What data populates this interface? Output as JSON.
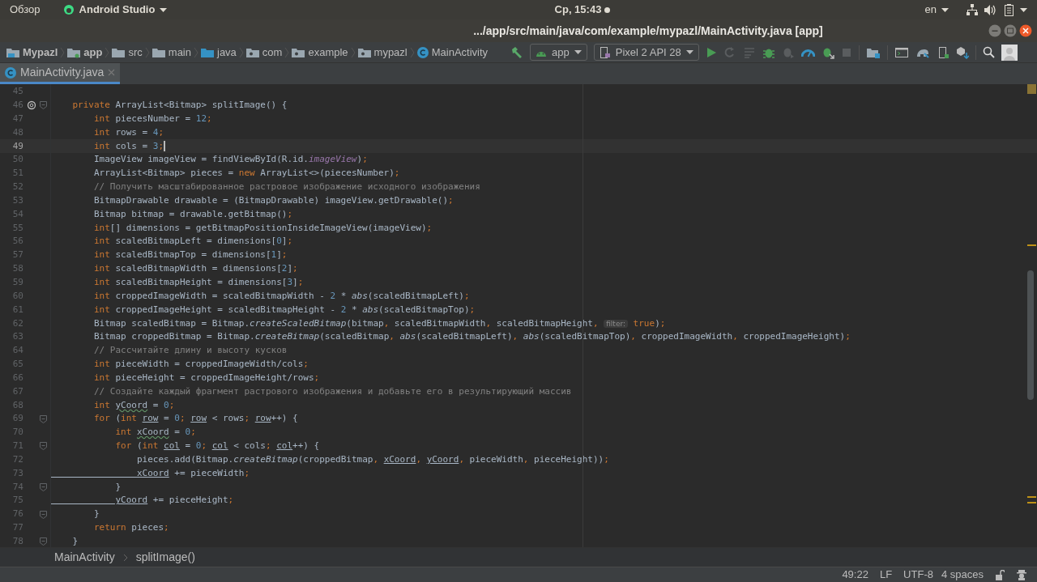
{
  "top_bar": {
    "activities": "Обзор",
    "app_menu": "Android Studio",
    "clock": "Ср, 15:43",
    "keyboard_layout": "en"
  },
  "window": {
    "title": ".../app/src/main/java/com/example/mypazl/MainActivity.java [app]"
  },
  "nav_path": [
    {
      "label": "Mypazl",
      "kind": "project"
    },
    {
      "label": "app",
      "kind": "module"
    },
    {
      "label": "src",
      "kind": "folder"
    },
    {
      "label": "main",
      "kind": "folder"
    },
    {
      "label": "java",
      "kind": "source"
    },
    {
      "label": "com",
      "kind": "package"
    },
    {
      "label": "example",
      "kind": "package"
    },
    {
      "label": "mypazl",
      "kind": "package"
    },
    {
      "label": "MainActivity",
      "kind": "class"
    }
  ],
  "toolbar": {
    "run_config": "app",
    "device": "Pixel 2 API 28"
  },
  "tabs": [
    {
      "label": "MainActivity.java",
      "selected": true
    }
  ],
  "editor": {
    "lines": [
      {
        "number": "45",
        "current": false,
        "override": false,
        "fold": false
      },
      {
        "number": "46",
        "current": false,
        "override": true,
        "fold": true,
        "tokens": [
          {
            "text": "    private",
            "kind": "keyword"
          },
          {
            "text": " ArrayList<Bitmap> splitImage() {",
            "kind": "plain"
          }
        ]
      },
      {
        "number": "47",
        "current": false,
        "override": false,
        "fold": false,
        "tokens": [
          {
            "text": "        int",
            "kind": "keyword"
          },
          {
            "text": " piecesNumber = ",
            "kind": "plain"
          },
          {
            "text": "12",
            "kind": "number"
          },
          {
            "text": ";",
            "kind": "keyword"
          }
        ]
      },
      {
        "number": "48",
        "current": false,
        "override": false,
        "fold": false,
        "tokens": [
          {
            "text": "        int",
            "kind": "keyword"
          },
          {
            "text": " rows = ",
            "kind": "plain"
          },
          {
            "text": "4",
            "kind": "number"
          },
          {
            "text": ";",
            "kind": "keyword"
          }
        ]
      },
      {
        "number": "49",
        "current": true,
        "override": false,
        "fold": false,
        "tokens": [
          {
            "text": "        int",
            "kind": "keyword"
          },
          {
            "text": " cols = ",
            "kind": "plain"
          },
          {
            "text": "3",
            "kind": "number"
          },
          {
            "text": ";",
            "kind": "keyword"
          }
        ]
      },
      {
        "number": "50",
        "current": false,
        "override": false,
        "fold": false,
        "tokens": [
          {
            "text": "        ImageView imageView = findViewById(R.id.",
            "kind": "plain"
          },
          {
            "text": "imageView",
            "kind": "field"
          },
          {
            "text": ")",
            "kind": "plain"
          },
          {
            "text": ";",
            "kind": "keyword"
          }
        ]
      },
      {
        "number": "51",
        "current": false,
        "override": false,
        "fold": false,
        "tokens": [
          {
            "text": "        ArrayList<Bitmap> pieces = ",
            "kind": "plain"
          },
          {
            "text": "new",
            "kind": "keyword"
          },
          {
            "text": " ArrayList<>(piecesNumber)",
            "kind": "plain"
          },
          {
            "text": ";",
            "kind": "keyword"
          }
        ]
      },
      {
        "number": "52",
        "current": false,
        "override": false,
        "fold": false,
        "tokens": [
          {
            "text": "        // Получить масштабированное растровое изображение исходного изображения",
            "kind": "comment"
          }
        ]
      },
      {
        "number": "53",
        "current": false,
        "override": false,
        "fold": false,
        "tokens": [
          {
            "text": "        BitmapDrawable drawable = (BitmapDrawable) imageView.getDrawable()",
            "kind": "plain"
          },
          {
            "text": ";",
            "kind": "keyword"
          }
        ]
      },
      {
        "number": "54",
        "current": false,
        "override": false,
        "fold": false,
        "tokens": [
          {
            "text": "        Bitmap bitmap = drawable.getBitmap()",
            "kind": "plain"
          },
          {
            "text": ";",
            "kind": "keyword"
          }
        ]
      },
      {
        "number": "55",
        "current": false,
        "override": false,
        "fold": false,
        "tokens": [
          {
            "text": "        int",
            "kind": "keyword"
          },
          {
            "text": "[] dimensions = getBitmapPositionInsideImageView(imageView)",
            "kind": "plain"
          },
          {
            "text": ";",
            "kind": "keyword"
          }
        ]
      },
      {
        "number": "56",
        "current": false,
        "override": false,
        "fold": false,
        "tokens": [
          {
            "text": "        int",
            "kind": "keyword"
          },
          {
            "text": " scaledBitmapLeft = dimensions[",
            "kind": "plain"
          },
          {
            "text": "0",
            "kind": "number"
          },
          {
            "text": "]",
            "kind": "plain"
          },
          {
            "text": ";",
            "kind": "keyword"
          }
        ]
      },
      {
        "number": "57",
        "current": false,
        "override": false,
        "fold": false,
        "tokens": [
          {
            "text": "        int",
            "kind": "keyword"
          },
          {
            "text": " scaledBitmapTop = dimensions[",
            "kind": "plain"
          },
          {
            "text": "1",
            "kind": "number"
          },
          {
            "text": "]",
            "kind": "plain"
          },
          {
            "text": ";",
            "kind": "keyword"
          }
        ]
      },
      {
        "number": "58",
        "current": false,
        "override": false,
        "fold": false,
        "tokens": [
          {
            "text": "        int",
            "kind": "keyword"
          },
          {
            "text": " scaledBitmapWidth = dimensions[",
            "kind": "plain"
          },
          {
            "text": "2",
            "kind": "number"
          },
          {
            "text": "]",
            "kind": "plain"
          },
          {
            "text": ";",
            "kind": "keyword"
          }
        ]
      },
      {
        "number": "59",
        "current": false,
        "override": false,
        "fold": false,
        "tokens": [
          {
            "text": "        int",
            "kind": "keyword"
          },
          {
            "text": " scaledBitmapHeight = dimensions[",
            "kind": "plain"
          },
          {
            "text": "3",
            "kind": "number"
          },
          {
            "text": "]",
            "kind": "plain"
          },
          {
            "text": ";",
            "kind": "keyword"
          }
        ]
      },
      {
        "number": "60",
        "current": false,
        "override": false,
        "fold": false,
        "tokens": [
          {
            "text": "        int",
            "kind": "keyword"
          },
          {
            "text": " croppedImageWidth = scaledBitmapWidth - ",
            "kind": "plain"
          },
          {
            "text": "2",
            "kind": "number"
          },
          {
            "text": " * ",
            "kind": "plain"
          },
          {
            "text": "abs",
            "kind": "static"
          },
          {
            "text": "(scaledBitmapLeft)",
            "kind": "plain"
          },
          {
            "text": ";",
            "kind": "keyword"
          }
        ]
      },
      {
        "number": "61",
        "current": false,
        "override": false,
        "fold": false,
        "tokens": [
          {
            "text": "        int",
            "kind": "keyword"
          },
          {
            "text": " croppedImageHeight = scaledBitmapHeight - ",
            "kind": "plain"
          },
          {
            "text": "2",
            "kind": "number"
          },
          {
            "text": " * ",
            "kind": "plain"
          },
          {
            "text": "abs",
            "kind": "static"
          },
          {
            "text": "(scaledBitmapTop)",
            "kind": "plain"
          },
          {
            "text": ";",
            "kind": "keyword"
          }
        ]
      },
      {
        "number": "62",
        "current": false,
        "override": false,
        "fold": false,
        "tokens": [
          {
            "text": "        Bitmap scaledBitmap = Bitmap.",
            "kind": "plain"
          },
          {
            "text": "createScaledBitmap",
            "kind": "static"
          },
          {
            "text": "(bitmap",
            "kind": "plain"
          },
          {
            "text": ",",
            "kind": "keyword"
          },
          {
            "text": " scaledBitmapWidth",
            "kind": "plain"
          },
          {
            "text": ",",
            "kind": "keyword"
          },
          {
            "text": " scaledBitmapHeight",
            "kind": "plain"
          },
          {
            "text": ", ",
            "kind": "keyword"
          },
          {
            "text": "filter:",
            "kind": "hint"
          },
          {
            "text": " true",
            "kind": "keyword"
          },
          {
            "text": ")",
            "kind": "plain"
          },
          {
            "text": ";",
            "kind": "keyword"
          }
        ]
      },
      {
        "number": "63",
        "current": false,
        "override": false,
        "fold": false,
        "tokens": [
          {
            "text": "        Bitmap croppedBitmap = Bitmap.",
            "kind": "plain"
          },
          {
            "text": "createBitmap",
            "kind": "static"
          },
          {
            "text": "(scaledBitmap",
            "kind": "plain"
          },
          {
            "text": ", ",
            "kind": "keyword"
          },
          {
            "text": "abs",
            "kind": "static"
          },
          {
            "text": "(scaledBitmapLeft)",
            "kind": "plain"
          },
          {
            "text": ", ",
            "kind": "keyword"
          },
          {
            "text": "abs",
            "kind": "static"
          },
          {
            "text": "(scaledBitmapTop)",
            "kind": "plain"
          },
          {
            "text": ",",
            "kind": "keyword"
          },
          {
            "text": " croppedImageWidth",
            "kind": "plain"
          },
          {
            "text": ",",
            "kind": "keyword"
          },
          {
            "text": " croppedImageHeight)",
            "kind": "plain"
          },
          {
            "text": ";",
            "kind": "keyword"
          }
        ]
      },
      {
        "number": "64",
        "current": false,
        "override": false,
        "fold": false,
        "tokens": [
          {
            "text": "        // Рассчитайте длину и высоту кусков",
            "kind": "comment"
          }
        ]
      },
      {
        "number": "65",
        "current": false,
        "override": false,
        "fold": false,
        "tokens": [
          {
            "text": "        int",
            "kind": "keyword"
          },
          {
            "text": " pieceWidth = croppedImageWidth/cols",
            "kind": "plain"
          },
          {
            "text": ";",
            "kind": "keyword"
          }
        ]
      },
      {
        "number": "66",
        "current": false,
        "override": false,
        "fold": false,
        "tokens": [
          {
            "text": "        int",
            "kind": "keyword"
          },
          {
            "text": " pieceHeight = croppedImageHeight/rows",
            "kind": "plain"
          },
          {
            "text": ";",
            "kind": "keyword"
          }
        ]
      },
      {
        "number": "67",
        "current": false,
        "override": false,
        "fold": false,
        "tokens": [
          {
            "text": "        // Создайте каждый фрагмент растрового изображения и добавьте его в результирующий массив",
            "kind": "comment"
          }
        ]
      },
      {
        "number": "68",
        "current": false,
        "override": false,
        "fold": false,
        "tokens": [
          {
            "text": "        int ",
            "kind": "keyword"
          },
          {
            "text": "yCoord",
            "kind": "typo"
          },
          {
            "text": " = ",
            "kind": "plain"
          },
          {
            "text": "0",
            "kind": "number"
          },
          {
            "text": ";",
            "kind": "keyword"
          }
        ]
      },
      {
        "number": "69",
        "current": false,
        "override": false,
        "fold": true,
        "tokens": [
          {
            "text": "        for",
            "kind": "keyword"
          },
          {
            "text": " (",
            "kind": "plain"
          },
          {
            "text": "int ",
            "kind": "keyword"
          },
          {
            "text": "row",
            "kind": "reassigned"
          },
          {
            "text": " = ",
            "kind": "plain"
          },
          {
            "text": "0",
            "kind": "number"
          },
          {
            "text": "; ",
            "kind": "keyword"
          },
          {
            "text": "row",
            "kind": "reassigned"
          },
          {
            "text": " < rows",
            "kind": "plain"
          },
          {
            "text": "; ",
            "kind": "keyword"
          },
          {
            "text": "row",
            "kind": "reassigned"
          },
          {
            "text": "++) {",
            "kind": "plain"
          }
        ]
      },
      {
        "number": "70",
        "current": false,
        "override": false,
        "fold": false,
        "tokens": [
          {
            "text": "            int ",
            "kind": "keyword"
          },
          {
            "text": "xCoord",
            "kind": "typo"
          },
          {
            "text": " = ",
            "kind": "plain"
          },
          {
            "text": "0",
            "kind": "number"
          },
          {
            "text": ";",
            "kind": "keyword"
          }
        ]
      },
      {
        "number": "71",
        "current": false,
        "override": false,
        "fold": true,
        "tokens": [
          {
            "text": "            for",
            "kind": "keyword"
          },
          {
            "text": " (",
            "kind": "plain"
          },
          {
            "text": "int ",
            "kind": "keyword"
          },
          {
            "text": "col",
            "kind": "reassigned"
          },
          {
            "text": " = ",
            "kind": "plain"
          },
          {
            "text": "0",
            "kind": "number"
          },
          {
            "text": "; ",
            "kind": "keyword"
          },
          {
            "text": "col",
            "kind": "reassigned"
          },
          {
            "text": " < cols",
            "kind": "plain"
          },
          {
            "text": "; ",
            "kind": "keyword"
          },
          {
            "text": "col",
            "kind": "reassigned"
          },
          {
            "text": "++) {",
            "kind": "plain"
          }
        ]
      },
      {
        "number": "72",
        "current": false,
        "override": false,
        "fold": false,
        "tokens": [
          {
            "text": "                pieces.add(Bitmap.",
            "kind": "plain"
          },
          {
            "text": "createBitmap",
            "kind": "static"
          },
          {
            "text": "(croppedBitmap",
            "kind": "plain"
          },
          {
            "text": ", ",
            "kind": "keyword"
          },
          {
            "text": "xCoord",
            "kind": "reassigned"
          },
          {
            "text": ", ",
            "kind": "keyword"
          },
          {
            "text": "yCoord",
            "kind": "reassigned"
          },
          {
            "text": ",",
            "kind": "keyword"
          },
          {
            "text": " pieceWidth",
            "kind": "plain"
          },
          {
            "text": ",",
            "kind": "keyword"
          },
          {
            "text": " pieceHeight))",
            "kind": "plain"
          },
          {
            "text": ";",
            "kind": "keyword"
          }
        ]
      },
      {
        "number": "73",
        "current": false,
        "override": false,
        "fold": false,
        "tokens": [
          {
            "text": "                xCoord",
            "kind": "reassigned"
          },
          {
            "text": " += pieceWidth",
            "kind": "plain"
          },
          {
            "text": ";",
            "kind": "keyword"
          }
        ]
      },
      {
        "number": "74",
        "current": false,
        "override": false,
        "fold": true,
        "tokens": [
          {
            "text": "            }",
            "kind": "plain"
          }
        ]
      },
      {
        "number": "75",
        "current": false,
        "override": false,
        "fold": false,
        "tokens": [
          {
            "text": "            yCoord",
            "kind": "reassigned"
          },
          {
            "text": " += pieceHeight",
            "kind": "plain"
          },
          {
            "text": ";",
            "kind": "keyword"
          }
        ]
      },
      {
        "number": "76",
        "current": false,
        "override": false,
        "fold": true,
        "tokens": [
          {
            "text": "        }",
            "kind": "plain"
          }
        ]
      },
      {
        "number": "77",
        "current": false,
        "override": false,
        "fold": false,
        "tokens": [
          {
            "text": "        return",
            "kind": "keyword"
          },
          {
            "text": " pieces",
            "kind": "plain"
          },
          {
            "text": ";",
            "kind": "keyword"
          }
        ]
      },
      {
        "number": "78",
        "current": false,
        "override": false,
        "fold": true,
        "tokens": [
          {
            "text": "    }",
            "kind": "plain"
          }
        ]
      }
    ]
  },
  "breadcrumbs": [
    "MainActivity",
    "splitImage()"
  ],
  "status_bar": {
    "position": "49:22",
    "line_separator": "LF",
    "encoding": "UTF-8",
    "indent": "4 spaces"
  }
}
